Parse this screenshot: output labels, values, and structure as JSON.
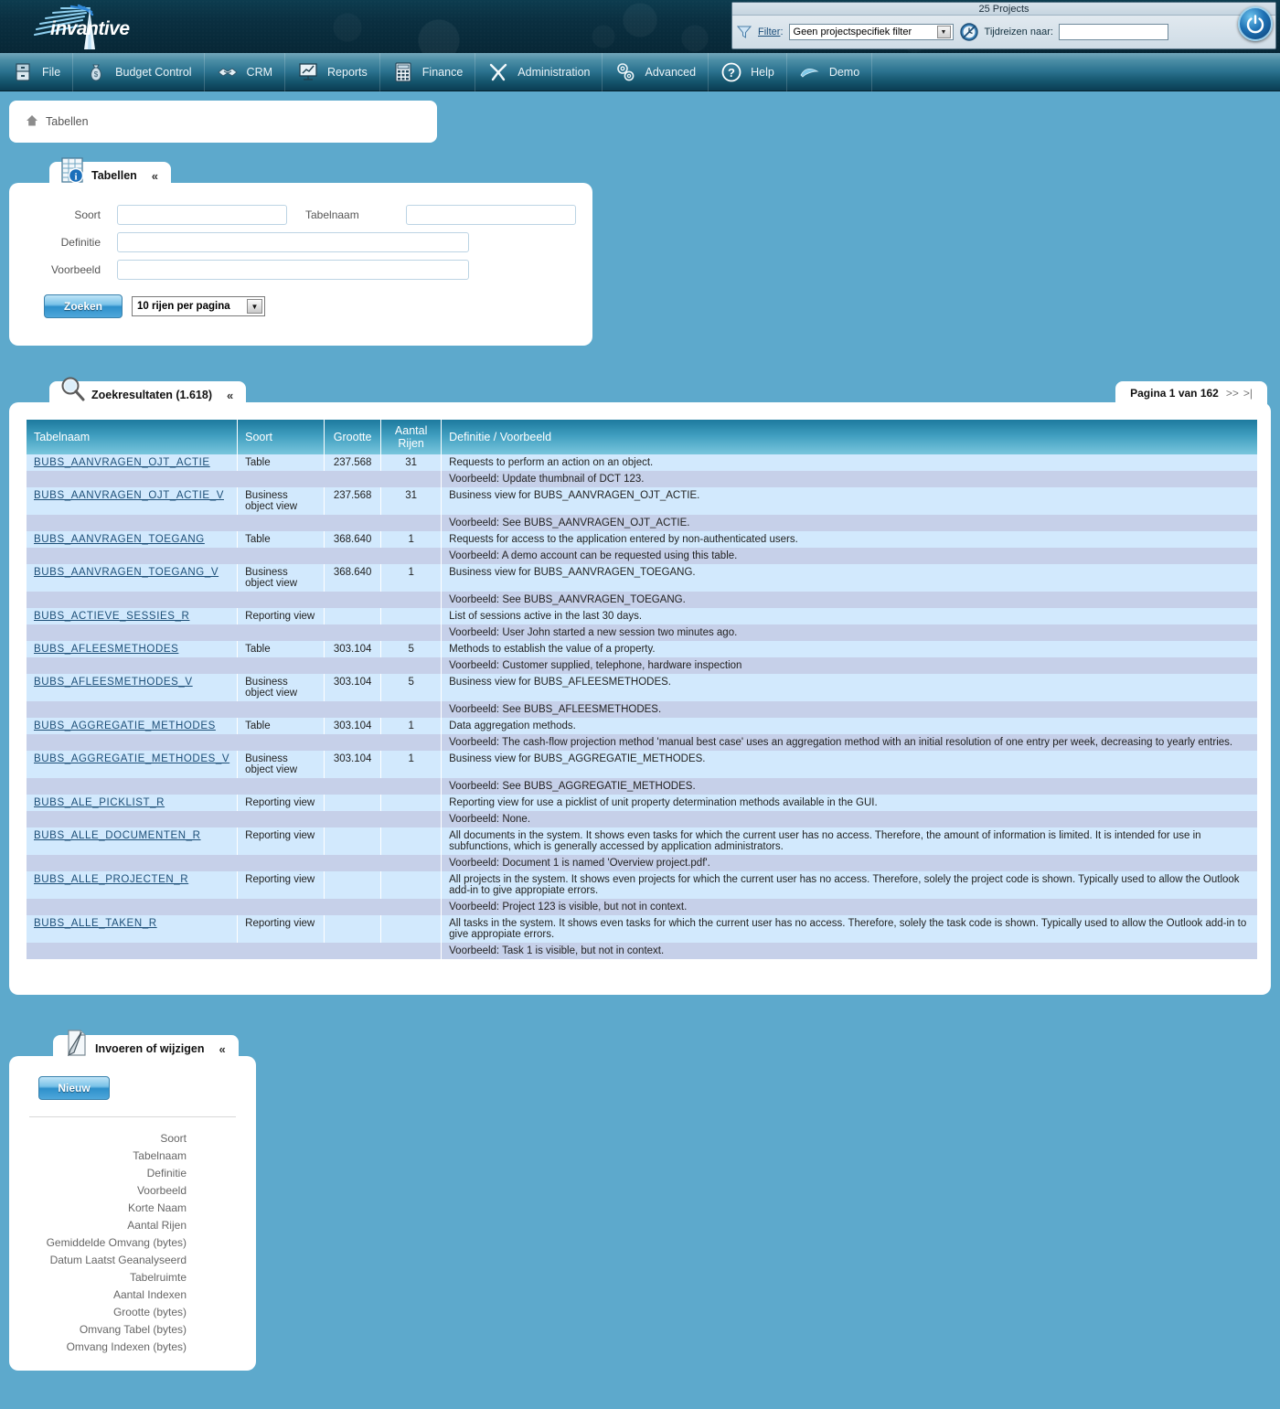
{
  "header": {
    "logo_text": "invantive",
    "projects_count_label": "25 Projects",
    "filter_label": "Filter",
    "filter_label_sep": ":",
    "filter_value": "Geen projectspecifiek filter",
    "time_travel_label": "Tijdreizen naar:",
    "time_travel_value": "",
    "icons": {
      "funnel": "funnel-icon",
      "clock": "time-travel-icon",
      "power": "power-icon"
    }
  },
  "menu": {
    "items": [
      {
        "label": "File",
        "icon": "cabinet-icon"
      },
      {
        "label": "Budget Control",
        "icon": "moneybag-icon"
      },
      {
        "label": "CRM",
        "icon": "handshake-icon"
      },
      {
        "label": "Reports",
        "icon": "presentation-icon"
      },
      {
        "label": "Finance",
        "icon": "calculator-icon"
      },
      {
        "label": "Administration",
        "icon": "tools-icon"
      },
      {
        "label": "Advanced",
        "icon": "gears-icon"
      },
      {
        "label": "Help",
        "icon": "question-icon"
      },
      {
        "label": "Demo",
        "icon": "wave-icon"
      }
    ]
  },
  "breadcrumb": {
    "home_icon": "home-icon",
    "label": "Tabellen"
  },
  "search_panel": {
    "tab_title": "Tabellen",
    "tab_icon": "table-info-icon",
    "collapse_icon": "chevron-up-icon",
    "fields": {
      "soort_label": "Soort",
      "soort_value": "",
      "tabelnaam_label": "Tabelnaam",
      "tabelnaam_value": "",
      "definitie_label": "Definitie",
      "definitie_value": "",
      "voorbeeld_label": "Voorbeeld",
      "voorbeeld_value": ""
    },
    "search_button": "Zoeken",
    "rows_per_page": "10 rijen per pagina"
  },
  "results_panel": {
    "tab_title": "Zoekresultaten (1.618)",
    "tab_icon": "magnifier-icon",
    "collapse_icon": "chevron-up-icon",
    "pager_text": "Pagina 1 van 162",
    "pager_next": ">>",
    "pager_last": ">|",
    "columns": [
      "Tabelnaam",
      "Soort",
      "Grootte",
      "Aantal Rijen",
      "Definitie / Voorbeeld"
    ],
    "rows": [
      {
        "name": "BUBS_AANVRAGEN_OJT_ACTIE",
        "soort": "Table",
        "grootte": "237.568",
        "aantal": "31",
        "definitie": "Requests to perform an action on an object.",
        "voorbeeld": "Voorbeeld: Update thumbnail of DCT 123."
      },
      {
        "name": "BUBS_AANVRAGEN_OJT_ACTIE_V",
        "soort": "Business object view",
        "grootte": "237.568",
        "aantal": "31",
        "definitie": "Business view for BUBS_AANVRAGEN_OJT_ACTIE.",
        "voorbeeld": "Voorbeeld: See BUBS_AANVRAGEN_OJT_ACTIE."
      },
      {
        "name": "BUBS_AANVRAGEN_TOEGANG",
        "soort": "Table",
        "grootte": "368.640",
        "aantal": "1",
        "definitie": "Requests for access to the application entered by non-authenticated users.",
        "voorbeeld": "Voorbeeld: A demo account can be requested using this table."
      },
      {
        "name": "BUBS_AANVRAGEN_TOEGANG_V",
        "soort": "Business object view",
        "grootte": "368.640",
        "aantal": "1",
        "definitie": "Business view for BUBS_AANVRAGEN_TOEGANG.",
        "voorbeeld": "Voorbeeld: See BUBS_AANVRAGEN_TOEGANG."
      },
      {
        "name": "BUBS_ACTIEVE_SESSIES_R",
        "soort": "Reporting view",
        "grootte": "",
        "aantal": "",
        "definitie": "List of sessions active in the last 30 days.",
        "voorbeeld": "Voorbeeld: User John started a new session two minutes ago."
      },
      {
        "name": "BUBS_AFLEESMETHODES",
        "soort": "Table",
        "grootte": "303.104",
        "aantal": "5",
        "definitie": "Methods to establish the value of a property.",
        "voorbeeld": "Voorbeeld: Customer supplied, telephone, hardware inspection"
      },
      {
        "name": "BUBS_AFLEESMETHODES_V",
        "soort": "Business object view",
        "grootte": "303.104",
        "aantal": "5",
        "definitie": "Business view for BUBS_AFLEESMETHODES.",
        "voorbeeld": "Voorbeeld: See BUBS_AFLEESMETHODES."
      },
      {
        "name": "BUBS_AGGREGATIE_METHODES",
        "soort": "Table",
        "grootte": "303.104",
        "aantal": "1",
        "definitie": "Data aggregation methods.",
        "voorbeeld": "Voorbeeld: The cash-flow projection method 'manual best case' uses an aggregation method with an initial resolution of one entry per week, decreasing to yearly entries."
      },
      {
        "name": "BUBS_AGGREGATIE_METHODES_V",
        "soort": "Business object view",
        "grootte": "303.104",
        "aantal": "1",
        "definitie": "Business view for BUBS_AGGREGATIE_METHODES.",
        "voorbeeld": "Voorbeeld: See BUBS_AGGREGATIE_METHODES."
      },
      {
        "name": "BUBS_ALE_PICKLIST_R",
        "soort": "Reporting view",
        "grootte": "",
        "aantal": "",
        "definitie": "Reporting view for use a picklist of unit property determination methods available in the GUI.",
        "voorbeeld": "Voorbeeld: None."
      },
      {
        "name": "BUBS_ALLE_DOCUMENTEN_R",
        "soort": "Reporting view",
        "grootte": "",
        "aantal": "",
        "definitie": "All documents in the system. It shows even tasks for which the current user has no access. Therefore, the amount of information is limited. It is intended for use in subfunctions, which is generally accessed by application administrators.",
        "voorbeeld": "Voorbeeld: Document 1 is named 'Overview project.pdf'."
      },
      {
        "name": "BUBS_ALLE_PROJECTEN_R",
        "soort": "Reporting view",
        "grootte": "",
        "aantal": "",
        "definitie": "All projects in the system. It shows even projects for which the current user has no access. Therefore, solely the project code is shown. Typically used to allow the Outlook add-in to give appropiate errors.",
        "voorbeeld": "Voorbeeld: Project 123 is visible, but not in context."
      },
      {
        "name": "BUBS_ALLE_TAKEN_R",
        "soort": "Reporting view",
        "grootte": "",
        "aantal": "",
        "definitie": "All tasks in the system. It shows even tasks for which the current user has no access. Therefore, solely the task code is shown. Typically used to allow the Outlook add-in to give appropiate errors.",
        "voorbeeld": "Voorbeeld: Task 1 is visible, but not in context."
      }
    ]
  },
  "edit_panel": {
    "tab_title": "Invoeren of wijzigen",
    "tab_icon": "pencil-document-icon",
    "collapse_icon": "chevron-up-icon",
    "new_button": "Nieuw",
    "fields": [
      "Soort",
      "Tabelnaam",
      "Definitie",
      "Voorbeeld",
      "Korte Naam",
      "Aantal Rijen",
      "Gemiddelde Omvang (bytes)",
      "Datum Laatst Geanalyseerd",
      "Tabelruimte",
      "Aantal Indexen",
      "Grootte (bytes)",
      "Omvang Tabel (bytes)",
      "Omvang Indexen (bytes)"
    ]
  },
  "colors": {
    "page_background": "#5da9cc",
    "banner_dark": "#0a2f40",
    "table_header_gradient_start": "#1d7a9e",
    "table_header_gradient_end": "#79c6dd",
    "row_main": "#d2e9fd",
    "row_sub": "#c6d0e9",
    "link": "#1d4f78"
  }
}
